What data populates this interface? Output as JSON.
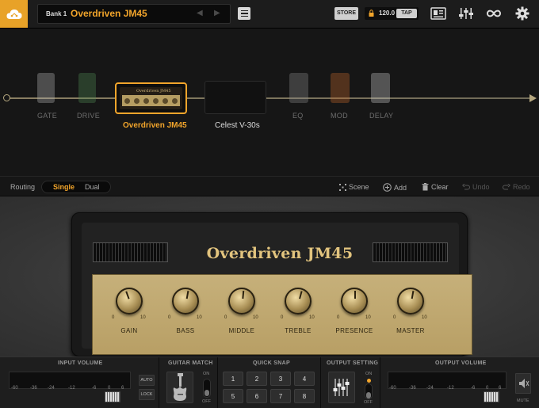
{
  "topbar": {
    "bank_label": "Bank 1",
    "preset_name": "Overdriven JM45",
    "store_label": "STORE",
    "tempo": "120.0",
    "tap_label": "TAP",
    "accent": "#f2a52b"
  },
  "chain": {
    "blocks": [
      {
        "label": "GATE"
      },
      {
        "label": "DRIVE"
      },
      {
        "label": "Overdriven JM45",
        "selected": true
      },
      {
        "label": "Celest V-30s"
      },
      {
        "label": "EQ"
      },
      {
        "label": "MOD"
      },
      {
        "label": "DELAY"
      }
    ],
    "amp_mini_logo": "Overdriven JM45"
  },
  "routing": {
    "label": "Routing",
    "single": "Single",
    "dual": "Dual",
    "scene": "Scene",
    "add": "Add",
    "clear": "Clear",
    "undo": "Undo",
    "redo": "Redo"
  },
  "amp": {
    "name": "Overdriven JM45",
    "knob_min": "0",
    "knob_max": "10",
    "knobs": [
      {
        "label": "GAIN",
        "rotation_deg": -20
      },
      {
        "label": "BASS",
        "rotation_deg": 10
      },
      {
        "label": "MIDDLE",
        "rotation_deg": 5
      },
      {
        "label": "TREBLE",
        "rotation_deg": 15
      },
      {
        "label": "PRESENCE",
        "rotation_deg": 0
      },
      {
        "label": "MASTER",
        "rotation_deg": 10
      }
    ]
  },
  "bottom": {
    "input_volume": {
      "title": "INPUT VOLUME",
      "scale": [
        "-60",
        "-36",
        "-24",
        "-12",
        "-6",
        "0",
        "6"
      ],
      "auto": "AUTO",
      "lock": "LOCK"
    },
    "guitar_match": {
      "title": "GUITAR MATCH",
      "on": "ON",
      "off": "OFF"
    },
    "quick_snap": {
      "title": "QUICK SNAP",
      "buttons": [
        "1",
        "2",
        "3",
        "4",
        "5",
        "6",
        "7",
        "8"
      ]
    },
    "output_setting": {
      "title": "OUTPUT SETTING",
      "on": "ON",
      "off": "OFF"
    },
    "output_volume": {
      "title": "OUTPUT VOLUME",
      "scale": [
        "-60",
        "-36",
        "-24",
        "-12",
        "-6",
        "0",
        "6"
      ],
      "mute": "MUTE"
    }
  }
}
